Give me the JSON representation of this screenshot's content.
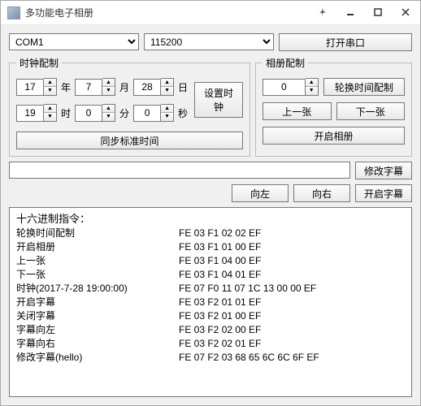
{
  "window": {
    "title": "多功能电子相册"
  },
  "toprow": {
    "com_selected": "COM1",
    "baud_selected": "115200",
    "open_port": "打开串口"
  },
  "clock": {
    "legend": "时钟配制",
    "year": "17",
    "year_unit": "年",
    "month": "7",
    "month_unit": "月",
    "day": "28",
    "day_unit": "日",
    "hour": "19",
    "hour_unit": "时",
    "minute": "0",
    "minute_unit": "分",
    "second": "0",
    "second_unit": "秒",
    "set_clock": "设置时钟",
    "sync_time": "同步标准时间"
  },
  "album": {
    "legend": "相册配制",
    "index": "0",
    "rotate_cfg": "轮换时间配制",
    "prev": "上一张",
    "next": "下一张",
    "open_album": "开启相册"
  },
  "subtitle": {
    "input": "",
    "modify": "修改字幕",
    "left": "向左",
    "right": "向右",
    "open": "开启字幕"
  },
  "log": {
    "header": "十六进制指令：",
    "lines": [
      {
        "label": "轮换时间配制",
        "hex": "FE 03 F1 02 02 EF"
      },
      {
        "label": "开启相册",
        "hex": "FE 03 F1 01 00 EF"
      },
      {
        "label": "上一张",
        "hex": "FE 03 F1 04 00 EF"
      },
      {
        "label": "下一张",
        "hex": "FE 03 F1 04 01 EF"
      },
      {
        "label": "时钟(2017-7-28 19:00:00)",
        "hex": "FE 07 F0 11 07 1C 13 00 00 EF"
      },
      {
        "label": "开启字幕",
        "hex": "FE 03 F2 01 01 EF"
      },
      {
        "label": "关闭字幕",
        "hex": "FE 03 F2 01 00 EF"
      },
      {
        "label": "字幕向左",
        "hex": "FE 03 F2 02 00 EF"
      },
      {
        "label": "字幕向右",
        "hex": "FE 03 F2 02 01 EF"
      },
      {
        "label": "修改字幕(hello)",
        "hex": "FE 07 F2 03 68 65 6C 6C 6F EF"
      }
    ]
  }
}
